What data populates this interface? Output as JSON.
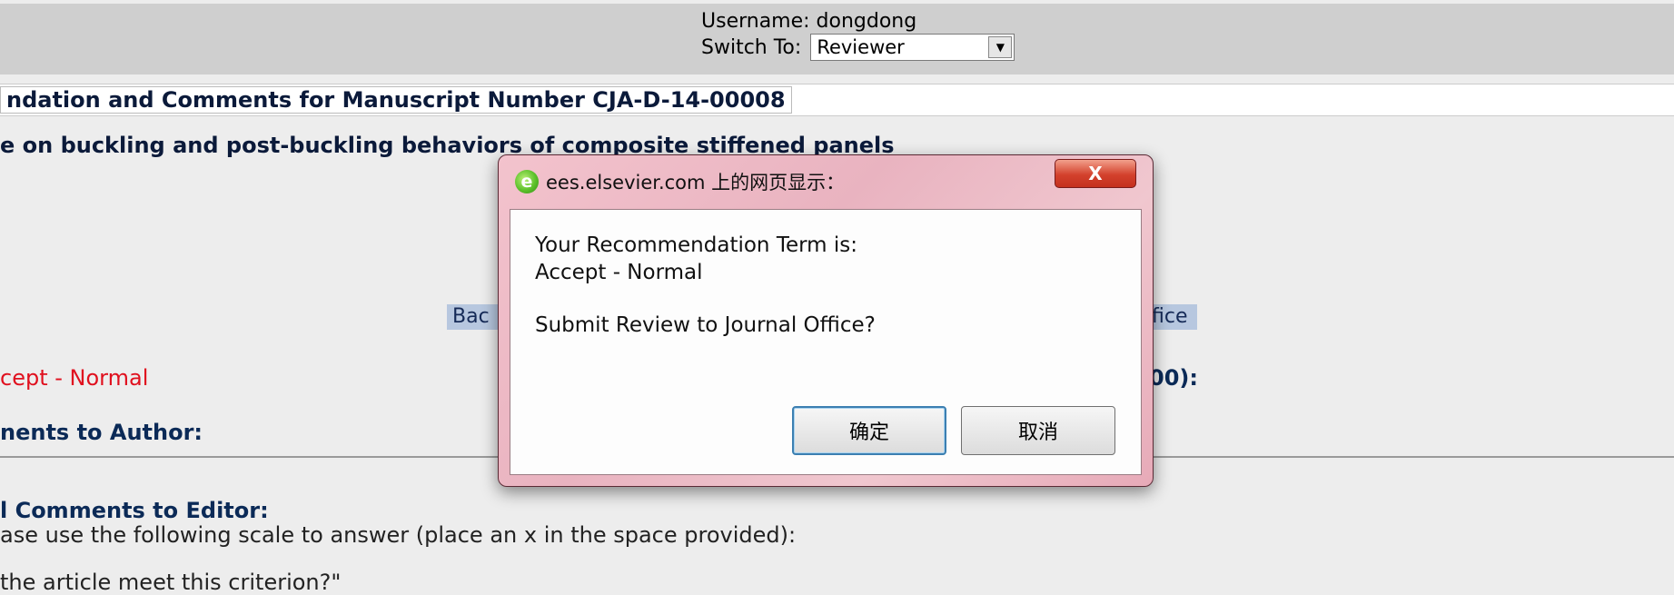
{
  "header": {
    "username_label": "Username: dongdong",
    "switch_label": "Switch To:",
    "role_selected": "Reviewer"
  },
  "page": {
    "manuscript_heading": "ndation and Comments for Manuscript Number CJA-D-14-00008",
    "article_title": "e on buckling and post-buckling behaviors of composite stiffened panels",
    "left_button_fragment": "Bac",
    "right_button_fragment": "fice",
    "recommendation_value": "cept - Normal",
    "score_fragment": "00):",
    "author_comments_heading": "nents to Author:",
    "editor_comments_heading": "l Comments to Editor:",
    "scale_instruction": "ase use the following scale to answer (place an x in the space provided):",
    "criterion_question": "the article meet this criterion?\""
  },
  "dialog": {
    "title": "ees.elsevier.com 上的网页显示：",
    "close_label": "X",
    "icon_glyph": "e",
    "line1": "Your Recommendation Term is:",
    "line2": "Accept - Normal",
    "line3": "Submit Review to Journal Office?",
    "ok_label": "确定",
    "cancel_label": "取消"
  },
  "colors": {
    "recommendation_red": "#e0101e",
    "heading_blue": "#0b2a57",
    "button_bg": "#b7c7df"
  }
}
